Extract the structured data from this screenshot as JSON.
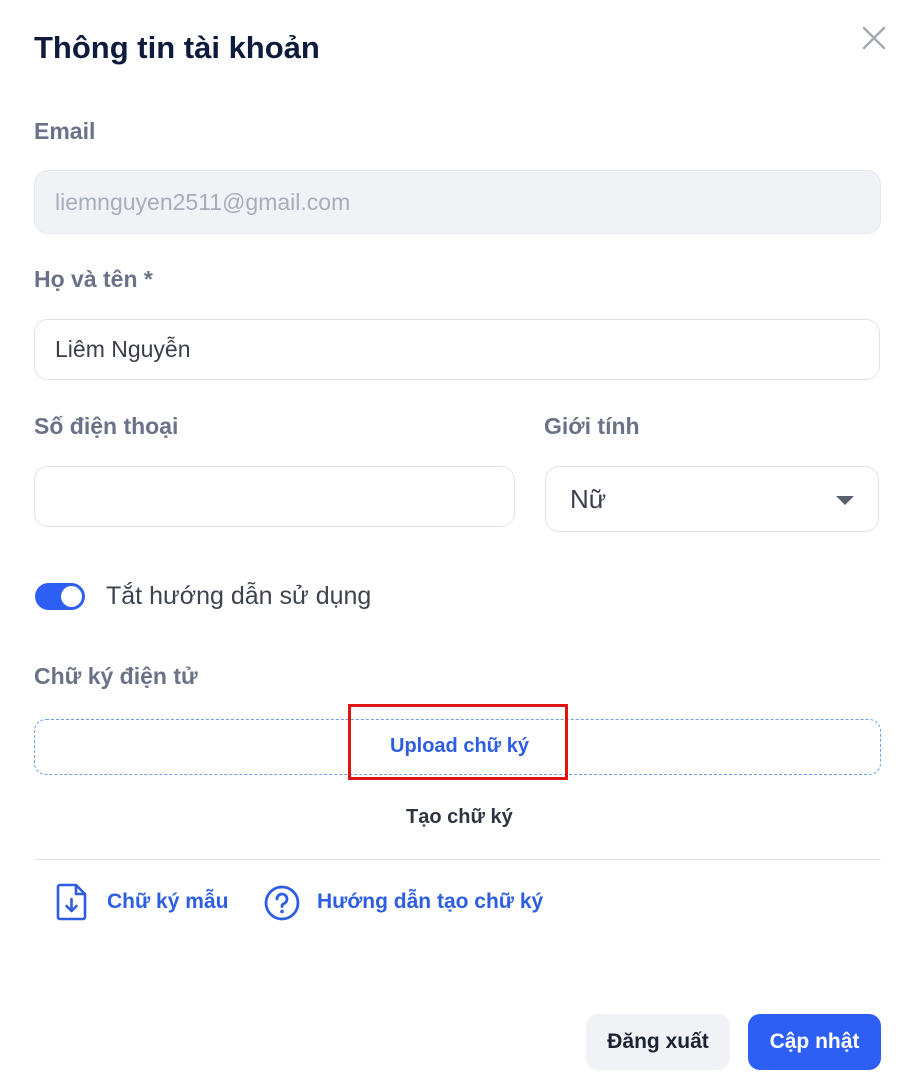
{
  "dialog": {
    "title": "Thông tin tài khoản",
    "close_icon": "close-icon"
  },
  "form": {
    "email_label": "Email",
    "email_value": "liemnguyen2511@gmail.com",
    "fullname_label": "Họ và tên *",
    "fullname_value": "Liêm Nguyễn",
    "phone_label": "Số điện thoại",
    "phone_value": "",
    "gender_label": "Giới tính",
    "gender_value": "Nữ",
    "tutorial_toggle_label": "Tắt hướng dẫn sử dụng",
    "tutorial_toggle_on": true,
    "signature_label": "Chữ ký điện tử",
    "upload_signature": "Upload chữ ký",
    "create_signature": "Tạo chữ ký"
  },
  "links": {
    "sample_signature": "Chữ ký mẫu",
    "signature_guide": "Hướng dẫn tạo chữ ký"
  },
  "footer": {
    "logout": "Đăng xuất",
    "update": "Cập nhật"
  },
  "colors": {
    "accent": "#2e5ff5",
    "link": "#2d5de0",
    "highlight": "#e11414"
  }
}
